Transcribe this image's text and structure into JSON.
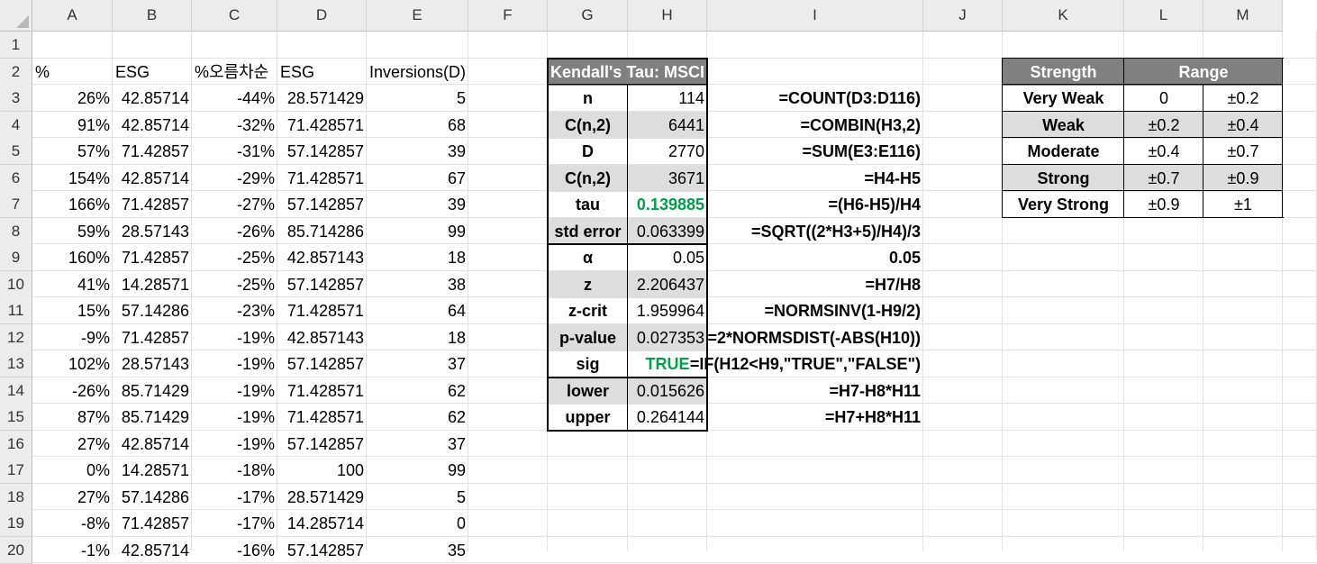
{
  "columns": [
    "A",
    "B",
    "C",
    "D",
    "E",
    "F",
    "G",
    "H",
    "I",
    "J",
    "K",
    "L",
    "M"
  ],
  "rows": [
    "1",
    "2",
    "3",
    "4",
    "5",
    "6",
    "7",
    "8",
    "9",
    "10",
    "11",
    "12",
    "13",
    "14",
    "15",
    "16",
    "17",
    "18",
    "19",
    "20"
  ],
  "headers_row2": {
    "A": "%",
    "B": "ESG",
    "C": "%오름차순",
    "D": "ESG",
    "E": "Inversions(D)"
  },
  "data_rows": [
    [
      "26%",
      "42.85714",
      "-44%",
      "28.571429",
      "5"
    ],
    [
      "91%",
      "42.85714",
      "-32%",
      "71.428571",
      "68"
    ],
    [
      "57%",
      "71.42857",
      "-31%",
      "57.142857",
      "39"
    ],
    [
      "154%",
      "42.85714",
      "-29%",
      "71.428571",
      "67"
    ],
    [
      "166%",
      "71.42857",
      "-27%",
      "57.142857",
      "39"
    ],
    [
      "59%",
      "28.57143",
      "-26%",
      "85.714286",
      "99"
    ],
    [
      "160%",
      "71.42857",
      "-25%",
      "42.857143",
      "18"
    ],
    [
      "41%",
      "14.28571",
      "-25%",
      "57.142857",
      "38"
    ],
    [
      "15%",
      "57.14286",
      "-23%",
      "71.428571",
      "64"
    ],
    [
      "-9%",
      "71.42857",
      "-19%",
      "42.857143",
      "18"
    ],
    [
      "102%",
      "28.57143",
      "-19%",
      "57.142857",
      "37"
    ],
    [
      "-26%",
      "85.71429",
      "-19%",
      "71.428571",
      "62"
    ],
    [
      "87%",
      "85.71429",
      "-19%",
      "71.428571",
      "62"
    ],
    [
      "27%",
      "42.85714",
      "-19%",
      "57.142857",
      "37"
    ],
    [
      "0%",
      "14.28571",
      "-18%",
      "100",
      "99"
    ],
    [
      "27%",
      "57.14286",
      "-17%",
      "28.571429",
      "5"
    ],
    [
      "-8%",
      "71.42857",
      "-17%",
      "14.285714",
      "0"
    ],
    [
      "-1%",
      "42.85714",
      "-16%",
      "57.142857",
      "35"
    ]
  ],
  "kendall": {
    "title": "Kendall's Tau: MSCI",
    "rows": [
      {
        "label": "n",
        "value": "114",
        "formula": "=COUNT(D3:D116)"
      },
      {
        "label": "C(n,2)",
        "value": "6441",
        "formula": "=COMBIN(H3,2)"
      },
      {
        "label": "D",
        "value": "2770",
        "formula": "=SUM(E3:E116)"
      },
      {
        "label": "C(n,2)",
        "value": "3671",
        "formula": "=H4-H5"
      },
      {
        "label": "tau",
        "value": "0.139885",
        "formula": "=(H6-H5)/H4"
      },
      {
        "label": "std error",
        "value": "0.063399",
        "formula": "=SQRT((2*H3+5)/H4)/3"
      },
      {
        "label": "α",
        "value": "0.05",
        "formula": "0.05"
      },
      {
        "label": "z",
        "value": "2.206437",
        "formula": "=H7/H8"
      },
      {
        "label": "z-crit",
        "value": "1.959964",
        "formula": "=NORMSINV(1-H9/2)"
      },
      {
        "label": "p-value",
        "value": "0.027353",
        "formula": "=2*NORMSDIST(-ABS(H10))"
      },
      {
        "label": "sig",
        "value": "TRUE",
        "formula": "=IF(H12<H9,\"TRUE\",\"FALSE\")"
      },
      {
        "label": "lower",
        "value": "0.015626",
        "formula": "=H7-H8*H11"
      },
      {
        "label": "upper",
        "value": "0.264144",
        "formula": "=H7+H8*H11"
      }
    ]
  },
  "strength": {
    "header_strength": "Strength",
    "header_range": "Range",
    "rows": [
      {
        "label": "Very Weak",
        "low": "0",
        "high": "±0.2"
      },
      {
        "label": "Weak",
        "low": "±0.2",
        "high": "±0.4"
      },
      {
        "label": "Moderate",
        "low": "±0.4",
        "high": "±0.7"
      },
      {
        "label": "Strong",
        "low": "±0.7",
        "high": "±0.9"
      },
      {
        "label": "Very Strong",
        "low": "±0.9",
        "high": "±1"
      }
    ]
  },
  "colors": {
    "highlight_green": "#00a04a",
    "header_gray": "#808080",
    "shade_gray": "#dddddd"
  }
}
